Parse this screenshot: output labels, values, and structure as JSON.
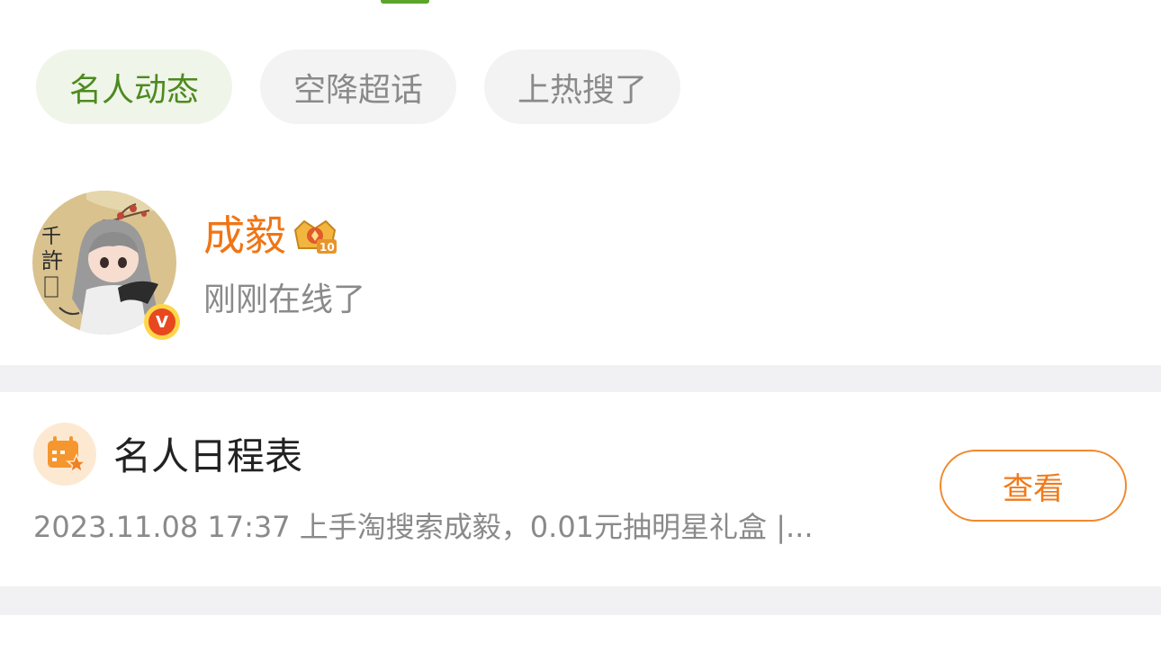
{
  "colors": {
    "accent_green": "#5aa52a",
    "name_orange": "#f07515",
    "button_orange": "#f07a1a"
  },
  "tabs": [
    {
      "label": "名人动态",
      "active": true
    },
    {
      "label": "空降超话",
      "active": false
    },
    {
      "label": "上热搜了",
      "active": false
    }
  ],
  "profile": {
    "name": "成毅",
    "status": "刚刚在线了",
    "badge_icon": "crown-level-icon",
    "verified_icon": "verified-v-icon"
  },
  "schedule": {
    "icon": "calendar-star-icon",
    "title": "名人日程表",
    "description": "2023.11.08 17:37 上手淘搜索成毅，0.01元抽明星礼盒 |...",
    "button_label": "查看"
  }
}
